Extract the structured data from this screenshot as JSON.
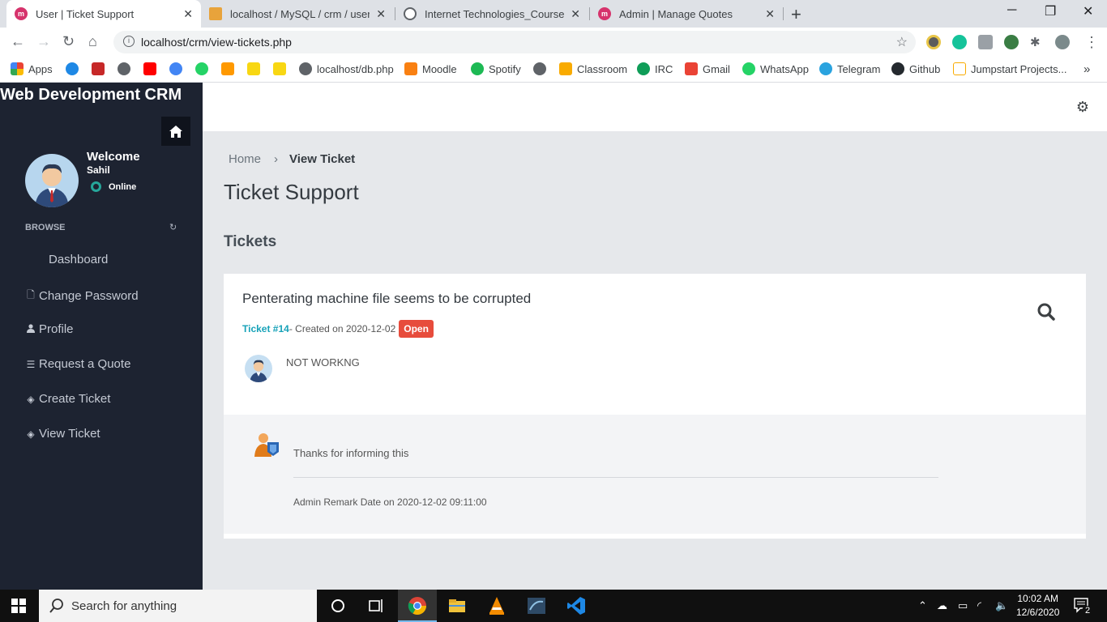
{
  "browser": {
    "tabs": [
      {
        "title": "User | Ticket Support",
        "active": true
      },
      {
        "title": "localhost / MySQL / crm / user | p",
        "active": false
      },
      {
        "title": "Internet Technologies_Course Eva",
        "active": false
      },
      {
        "title": "Admin | Manage Quotes",
        "active": false
      }
    ],
    "url": "localhost/crm/view-tickets.php",
    "bookmarks": [
      "Apps",
      "localhost/db.php",
      "Moodle",
      "Spotify",
      "Classroom",
      "IRC",
      "Gmail",
      "WhatsApp",
      "Telegram",
      "Github",
      "Jumpstart Projects..."
    ]
  },
  "sidebar": {
    "brand": "Web Development CRM",
    "welcome": "Welcome",
    "username": "Sahil",
    "status": "Online",
    "section": "BROWSE",
    "items": [
      {
        "label": "Dashboard",
        "icon": ""
      },
      {
        "label": "Change Password",
        "icon": "file-icon"
      },
      {
        "label": "Profile",
        "icon": "user-icon"
      },
      {
        "label": "Request a Quote",
        "icon": "list-icon"
      },
      {
        "label": "Create Ticket",
        "icon": "tag-icon"
      },
      {
        "label": "View Ticket",
        "icon": "tag-icon"
      }
    ]
  },
  "main": {
    "breadcrumb": {
      "home": "Home",
      "current": "View Ticket"
    },
    "page_title": "Ticket Support",
    "section_title": "Tickets",
    "ticket": {
      "title": "Penterating machine file seems to be corrupted",
      "number": "Ticket #14",
      "created": " - Created on 2020-12-02",
      "status": "Open",
      "message": "NOT WORKNG"
    },
    "reply": {
      "message": "Thanks for informing this",
      "date": "Admin Remark Date on 2020-12-02 09:11:00"
    }
  },
  "taskbar": {
    "search_placeholder": "Search for anything",
    "time": "10:02 AM",
    "date": "12/6/2020",
    "notifications": "2"
  },
  "colors": {
    "sidebar_bg": "#1d2331",
    "badge_open": "#e74c3c",
    "ticket_link": "#17a2b8"
  }
}
